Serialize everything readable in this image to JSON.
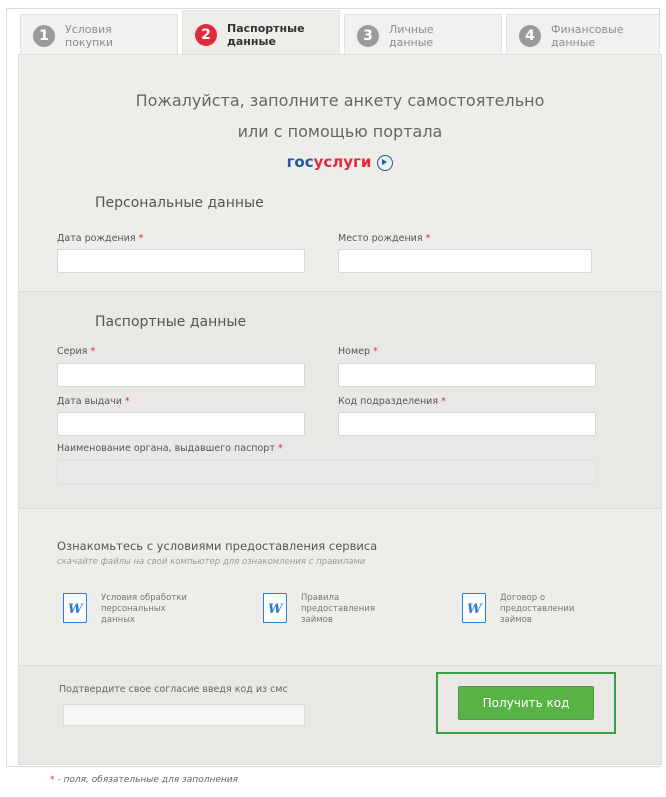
{
  "tabs": [
    {
      "num": "1",
      "label": "Условия\nпокупки",
      "active": false
    },
    {
      "num": "2",
      "label": "Паспортные\nданные",
      "active": true
    },
    {
      "num": "3",
      "label": "Личные\nданные",
      "active": false
    },
    {
      "num": "4",
      "label": "Финансовые\nданные",
      "active": false
    }
  ],
  "intro": {
    "line1": "Пожалуйста, заполните анкету самостоятельно",
    "line2": "или с помощью портала",
    "gos_part1": "гос",
    "gos_part2": "услуги"
  },
  "personal": {
    "title": "Персональные данные",
    "birth_date_label": "Дата рождения",
    "birth_place_label": "Место рождения"
  },
  "passport": {
    "title": "Паспортные данные",
    "series_label": "Серия",
    "number_label": "Номер",
    "issue_date_label": "Дата выдачи",
    "dept_code_label": "Код подразделения",
    "issuer_label": "Наименование органа, выдавшего паспорт"
  },
  "terms": {
    "heading": "Ознакомьтесь с условиями предоставления сервиса",
    "subheading": "скачайте файлы на свой компьютер для ознакомления с правилами",
    "docs": [
      "Условия обработки\nперсональных\nданных",
      "Правила\nпредоставления\nзаймов",
      "Договор о\nпредоставлении\nзаймов"
    ]
  },
  "sms": {
    "label": "Подтвердите свое согласие введя код из смс",
    "button": "Получить код"
  },
  "required_mark": "*",
  "footnote": "- поля, обязательные для заполнения",
  "colors": {
    "accent_red": "#e02b3d",
    "button_green": "#58b347",
    "word_blue": "#2a7fd1",
    "gos_blue": "#1f5aa6"
  }
}
